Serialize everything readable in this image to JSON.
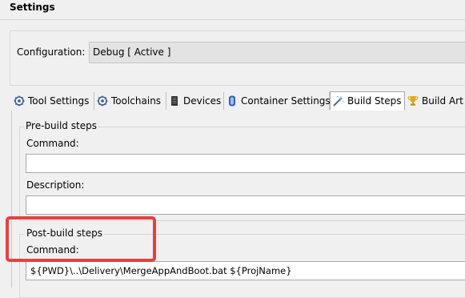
{
  "window": {
    "title": "Settings"
  },
  "configuration": {
    "label": "Configuration:",
    "value": "Debug  [ Active ]"
  },
  "tabs": [
    {
      "label": "Tool Settings",
      "icon": "gear-icon",
      "active": false
    },
    {
      "label": "Toolchains",
      "icon": "gear-icon",
      "active": false
    },
    {
      "label": "Devices",
      "icon": "device-icon",
      "active": false
    },
    {
      "label": "Container Settings",
      "icon": "container-icon",
      "active": false
    },
    {
      "label": "Build Steps",
      "icon": "wand-icon",
      "active": true
    },
    {
      "label": "Build Art",
      "icon": "trophy-icon",
      "active": false
    }
  ],
  "prebuild": {
    "title": "Pre-build steps",
    "command_label": "Command:",
    "command_value": "",
    "description_label": "Description:",
    "description_value": ""
  },
  "postbuild": {
    "title": "Post-build steps",
    "command_label": "Command:",
    "command_value": "${PWD}\\..\\Delivery\\MergeAppAndBoot.bat ${ProjName}"
  },
  "colors": {
    "highlight": "#e8403f",
    "active_tab": "#ffffff",
    "panel": "#f0f0f0"
  }
}
